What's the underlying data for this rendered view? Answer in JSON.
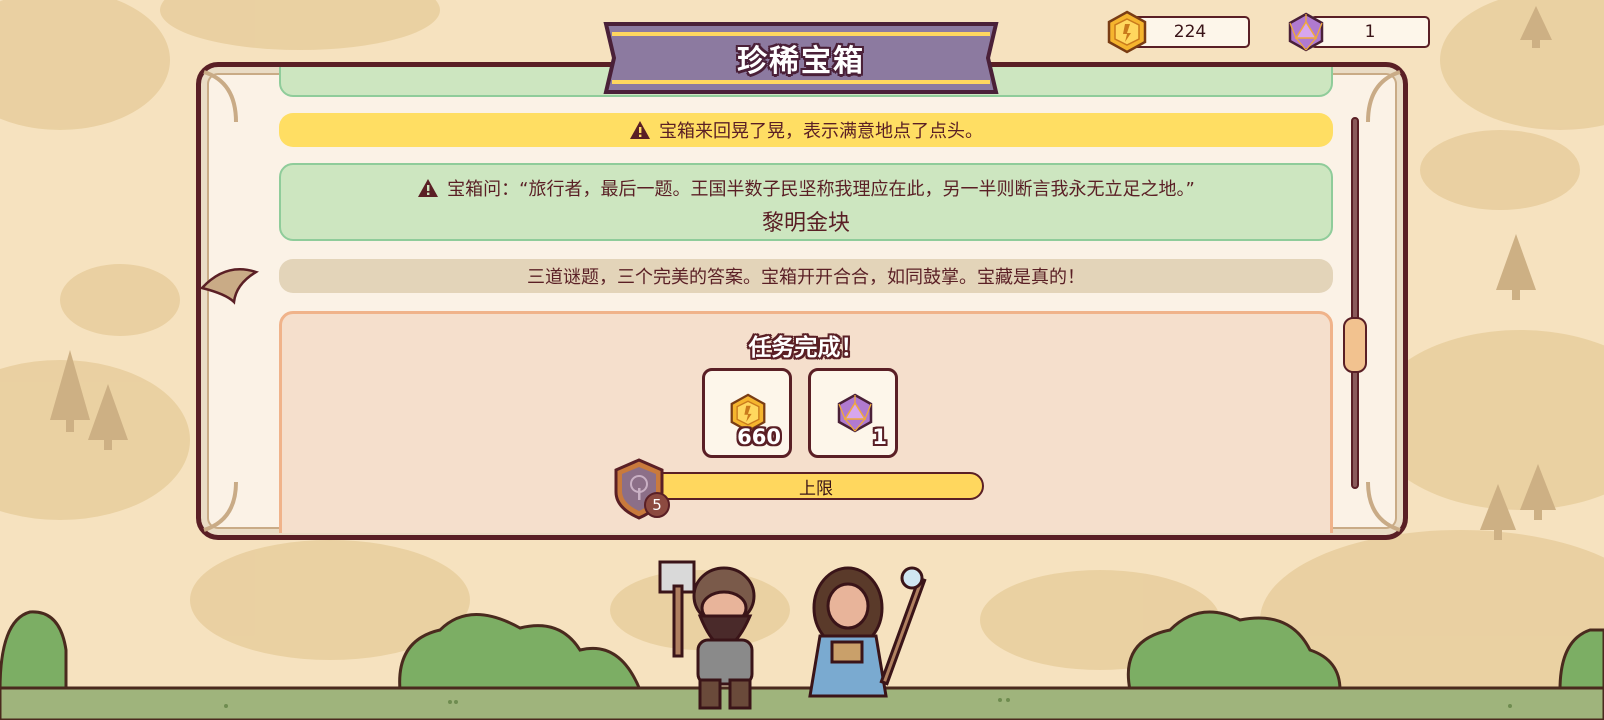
{
  "title": "珍稀宝箱",
  "currencies": {
    "gold": {
      "icon": "gold-coin-icon",
      "value": "224"
    },
    "gem": {
      "icon": "d20-gem-icon",
      "value": "1"
    }
  },
  "log": {
    "yellow_message": "宝箱来回晃了晃，表示满意地点了点头。",
    "green_question": "宝箱问：“旅行者，最后一题。王国半数子民坚称我理应在此，另一半则断言我永无立足之地。”",
    "green_answer": "黎明金块",
    "grey_message": "三道谜题，三个完美的答案。宝箱开开合合，如同鼓掌。宝藏是真的！"
  },
  "quest": {
    "title": "任务完成！",
    "rewards": [
      {
        "icon": "gold-coin-icon",
        "quantity": "660"
      },
      {
        "icon": "d20-gem-icon",
        "quantity": "1"
      }
    ],
    "level": "5",
    "bar_label": "上限",
    "bar_progress": 1.0
  },
  "colors": {
    "background": "#f6e2bf",
    "title_banner": "#8c7aa0",
    "yellow_banner": "#ffde63",
    "green_box": "#cde6c0",
    "outline": "#5a1f25"
  }
}
